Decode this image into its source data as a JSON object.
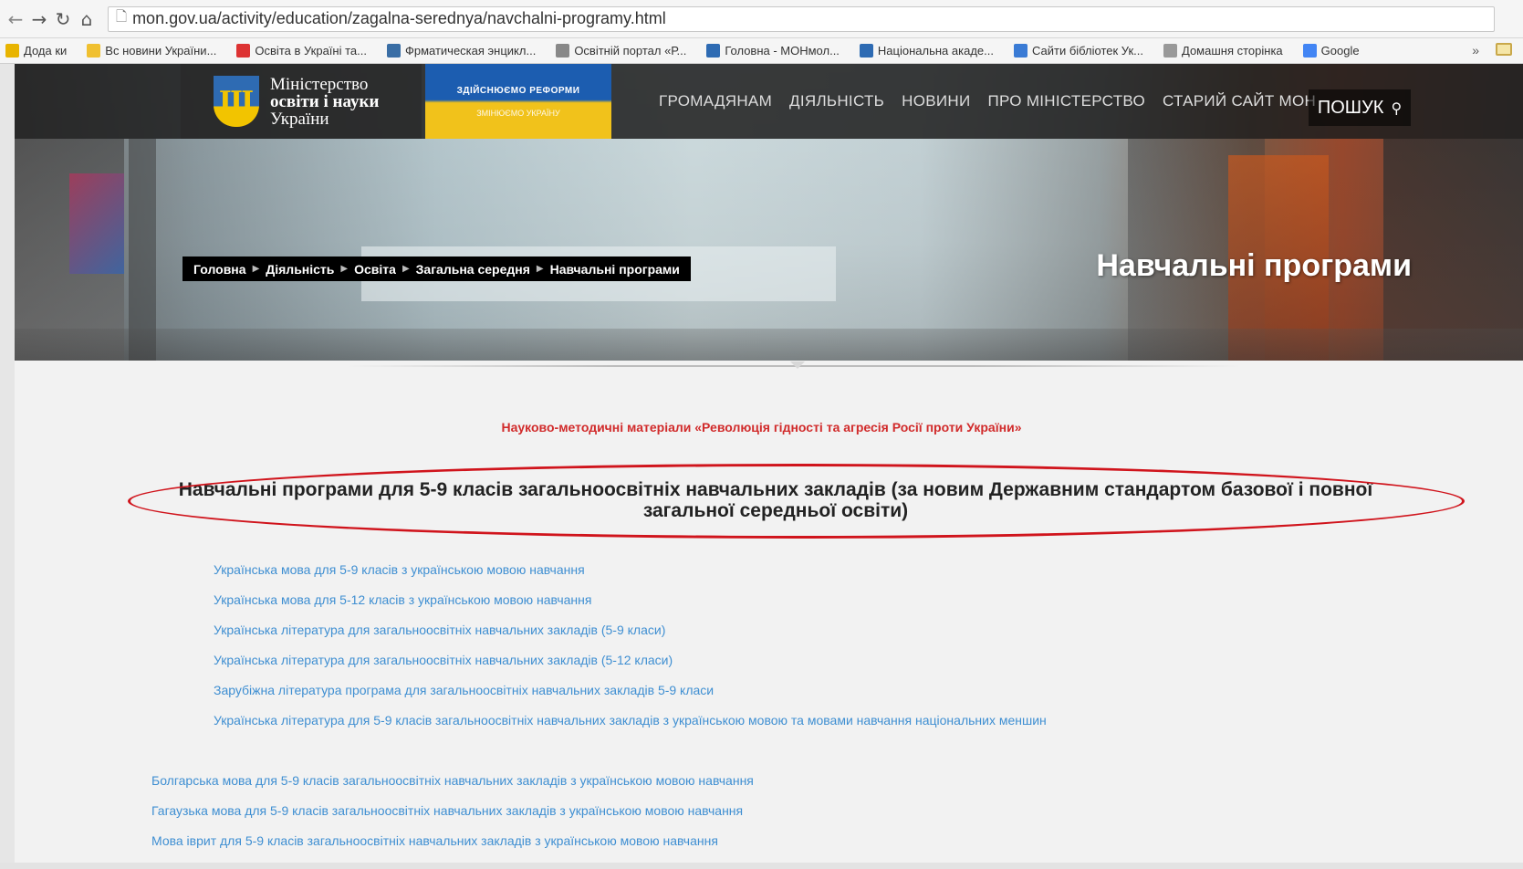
{
  "browser": {
    "url": "mon.gov.ua/activity/education/zagalna-serednya/navchalni-programy.html",
    "bookmarks": [
      {
        "label": "Дода ки",
        "icon": "apps-icon",
        "color": "#e8b400"
      },
      {
        "label": "Вс новини України...",
        "icon": "news-icon",
        "color": "#f0c030"
      },
      {
        "label": "Освіта в Україні та...",
        "icon": "edu-icon",
        "color": "#d33"
      },
      {
        "label": "Фрматическая энцикл...",
        "icon": "wiki-icon",
        "color": "#3a6ea5"
      },
      {
        "label": "Освітній портал «Р...",
        "icon": "portal-icon",
        "color": "#888"
      },
      {
        "label": "Головна - МОНмол...",
        "icon": "mon-icon",
        "color": "#2e6bb3"
      },
      {
        "label": "Національна акаде...",
        "icon": "academy-icon",
        "color": "#2e6bb3"
      },
      {
        "label": "Сайти бібліотек Ук...",
        "icon": "library-icon",
        "color": "#3a7bd5"
      },
      {
        "label": "Домашня сторінка",
        "icon": "page-icon",
        "color": "#999"
      },
      {
        "label": "Google",
        "icon": "google-icon",
        "color": "#4285f4"
      }
    ],
    "more": "»"
  },
  "header": {
    "logo_line1": "Міністерство",
    "logo_line2": "освіти і науки",
    "logo_line3": "України",
    "reform_line1": "ЗДІЙСНЮЄМО РЕФОРМИ",
    "reform_line2": "ЗМІНЮЄМО УКРАЇНУ",
    "menu": [
      "ГРОМАДЯНАМ",
      "ДІЯЛЬНІСТЬ",
      "НОВИНИ",
      "ПРО МІНІСТЕРСТВО",
      "СТАРИЙ САЙТ МОН"
    ],
    "search_label": "ПОШУК"
  },
  "breadcrumb": [
    "Головна",
    "Діяльність",
    "Освіта",
    "Загальна середня",
    "Навчальні програми"
  ],
  "page_title": "Навчальні програми",
  "content": {
    "red_link": "Науково-методичні матеріали «Революція гідності та агресія Росії проти України»",
    "section_title_line1": "Навчальні програми для 5-9 класів загальноосвітніх навчальних закладів (за новим Державним стандартом базової і повної",
    "section_title_line2": "загальної середньої освіти)",
    "links_group1": [
      "Українська мова для 5-9 класів з українською мовою навчання",
      "Українська мова для 5-12 класів з українською мовою навчання",
      "Українська література для загальноосвітніх навчальних закладів (5-9 класи)",
      "Українська література для загальноосвітніх навчальних закладів (5-12 класи)",
      "Зарубіжна література програма для загальноосвітніх навчальних закладів 5-9 класи",
      "Українська література  для 5-9 класів загальноосвітніх навчальних закладів з українською мовою та мовами навчання національних меншин"
    ],
    "links_group2": [
      "Болгарська мова для 5-9 класів загальноосвітніх навчальних закладів з українською мовою навчання",
      "Гагаузька мова для 5-9 класів загальноосвітніх навчальних закладів з українською мовою навчання",
      "Мова іврит для 5-9 класів загальноосвітніх навчальних закладів з українською мовою навчання"
    ]
  },
  "colors": {
    "link": "#3f8fd2",
    "red_link": "#d12b2b",
    "highlight_oval": "#d0141c",
    "header_bg": "#1e1e1e"
  }
}
